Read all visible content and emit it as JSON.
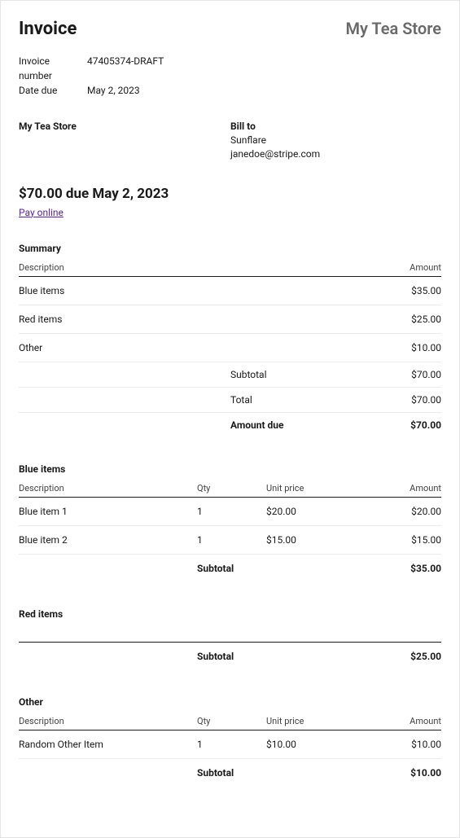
{
  "header": {
    "title": "Invoice",
    "store_name": "My Tea Store"
  },
  "meta": {
    "invoice_number_label": "Invoice number",
    "invoice_number": "47405374-DRAFT",
    "date_due_label": "Date due",
    "date_due": "May 2, 2023"
  },
  "from": {
    "name": "My Tea Store"
  },
  "bill_to": {
    "heading": "Bill to",
    "name": "Sunflare",
    "email": "janedoe@stripe.com"
  },
  "due": {
    "line": "$70.00 due May 2, 2023",
    "pay_link": "Pay online"
  },
  "summary": {
    "heading": "Summary",
    "cols": {
      "description": "Description",
      "amount": "Amount"
    },
    "rows": [
      {
        "description": "Blue items",
        "amount": "$35.00"
      },
      {
        "description": "Red items",
        "amount": "$25.00"
      },
      {
        "description": "Other",
        "amount": "$10.00"
      }
    ],
    "totals": [
      {
        "label": "Subtotal",
        "value": "$70.00",
        "bold": false
      },
      {
        "label": "Total",
        "value": "$70.00",
        "bold": false
      },
      {
        "label": "Amount due",
        "value": "$70.00",
        "bold": true
      }
    ]
  },
  "groups": [
    {
      "heading": "Blue items",
      "cols": {
        "description": "Description",
        "qty": "Qty",
        "unit": "Unit price",
        "amount": "Amount"
      },
      "rows": [
        {
          "description": "Blue item 1",
          "qty": "1",
          "unit": "$20.00",
          "amount": "$20.00"
        },
        {
          "description": "Blue item 2",
          "qty": "1",
          "unit": "$15.00",
          "amount": "$15.00"
        }
      ],
      "subtotal_label": "Subtotal",
      "subtotal": "$35.00"
    },
    {
      "heading": "Red items",
      "cols": null,
      "rows": [],
      "subtotal_label": "Subtotal",
      "subtotal": "$25.00"
    },
    {
      "heading": "Other",
      "cols": {
        "description": "Description",
        "qty": "Qty",
        "unit": "Unit price",
        "amount": "Amount"
      },
      "rows": [
        {
          "description": "Random Other Item",
          "qty": "1",
          "unit": "$10.00",
          "amount": "$10.00"
        }
      ],
      "subtotal_label": "Subtotal",
      "subtotal": "$10.00"
    }
  ]
}
